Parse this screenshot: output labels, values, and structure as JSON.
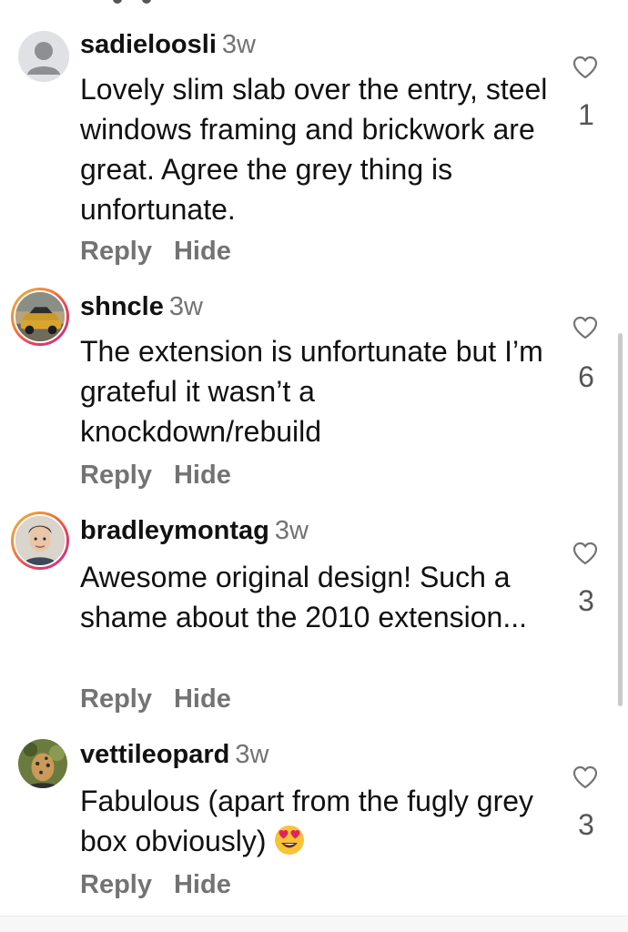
{
  "comments": [
    {
      "username": "sadieloosli",
      "time": "3w",
      "text": "Lovely slim slab over the entry, steel windows framing and brickwork are great. Agree the grey thing is unfortunate.",
      "likes": "1",
      "reply_label": "Reply",
      "hide_label": "Hide"
    },
    {
      "username": "shncle",
      "time": "3w",
      "text": "The extension is unfortunate but I’m grateful it wasn’t a knockdown/rebuild",
      "likes": "6",
      "reply_label": "Reply",
      "hide_label": "Hide"
    },
    {
      "username": "bradleymontag",
      "time": "3w",
      "text": "Awesome original design! Such a shame about the 2010 extension...",
      "likes": "3",
      "reply_label": "Reply",
      "hide_label": "Hide"
    },
    {
      "username": "vettileopard",
      "time": "3w",
      "text": "Fabulous (apart from the fugly grey box obviously)",
      "likes": "3",
      "reply_label": "Reply",
      "hide_label": "Hide"
    }
  ],
  "icons": {
    "like": "heart-outline-icon",
    "emoji": "heart-eyes-emoji"
  },
  "colors": {
    "muted": "#737373",
    "story_ring": "#e4405f"
  }
}
